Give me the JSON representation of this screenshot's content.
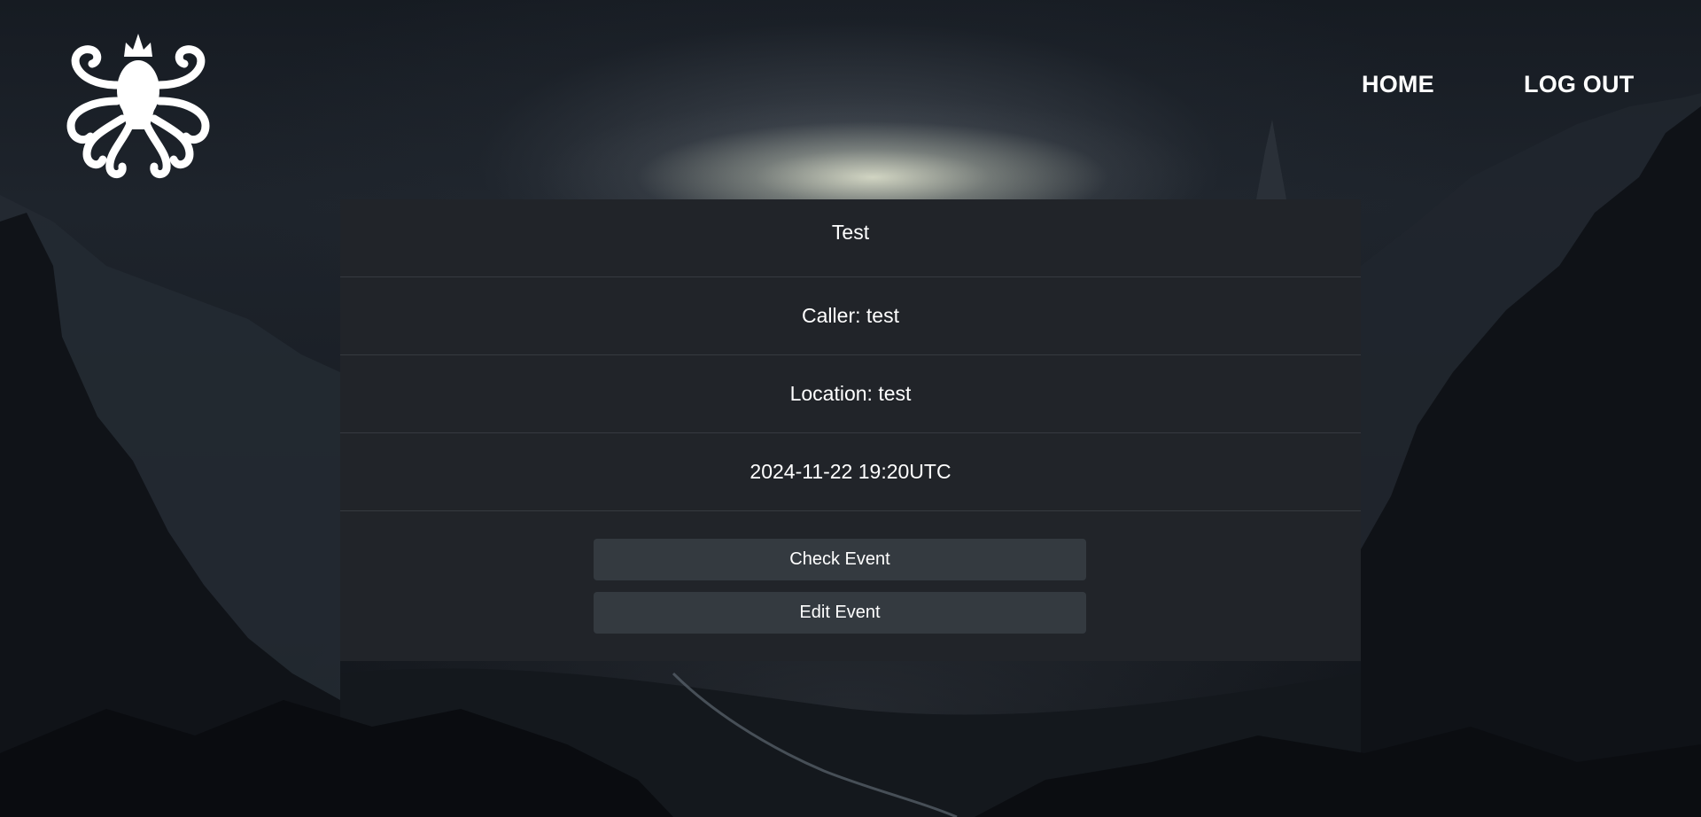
{
  "nav": {
    "home": "HOME",
    "logout": "LOG OUT"
  },
  "logo": {
    "icon": "octopus-icon"
  },
  "event": {
    "title": "Test",
    "caller": "Caller: test",
    "location": "Location: test",
    "datetime": "2024-11-22 19:20UTC"
  },
  "actions": {
    "check_label": "Check Event",
    "edit_label": "Edit Event"
  },
  "colors": {
    "card_bg": "#212429",
    "button_bg": "#343a40",
    "text": "#ffffff"
  }
}
